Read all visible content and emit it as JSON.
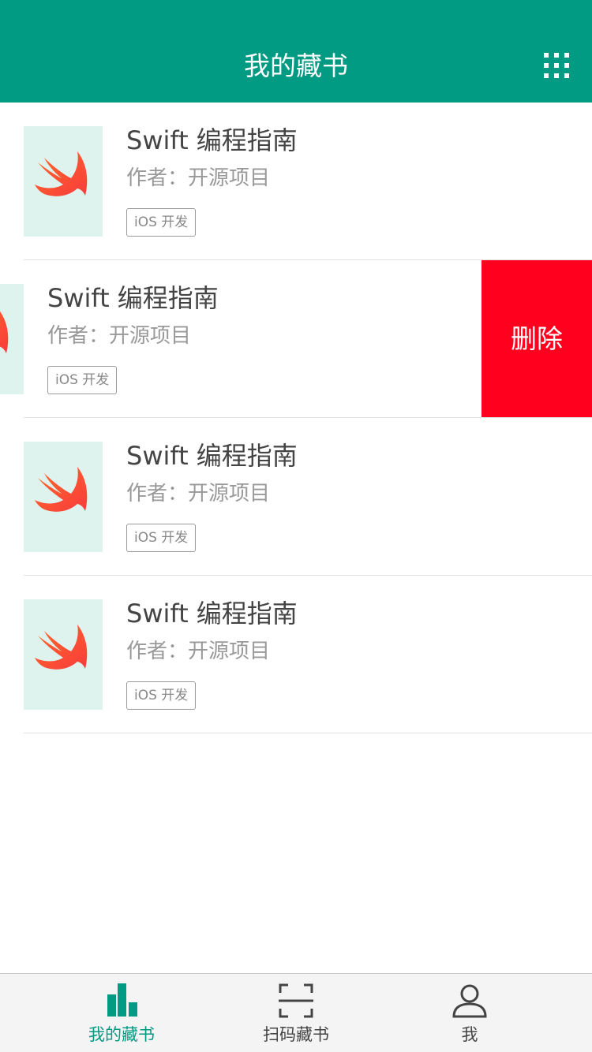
{
  "header": {
    "title": "我的藏书",
    "menu_icon": "grid-icon"
  },
  "colors": {
    "primary": "#009b82",
    "delete": "#ff001e",
    "cover_bg": "#def2ee"
  },
  "books": [
    {
      "title": "Swift 编程指南",
      "author": "作者：开源项目",
      "tag": "iOS 开发"
    },
    {
      "title": "Swift 编程指南",
      "author": "作者：开源项目",
      "tag": "iOS 开发",
      "delete_label": "删除"
    },
    {
      "title": "Swift 编程指南",
      "author": "作者：开源项目",
      "tag": "iOS 开发"
    },
    {
      "title": "Swift 编程指南",
      "author": "作者：开源项目",
      "tag": "iOS 开发"
    }
  ],
  "tabbar": {
    "items": [
      {
        "label": "我的藏书",
        "icon": "bar-chart-icon",
        "active": true
      },
      {
        "label": "扫码藏书",
        "icon": "scan-icon",
        "active": false
      },
      {
        "label": "我",
        "icon": "user-icon",
        "active": false
      }
    ]
  }
}
